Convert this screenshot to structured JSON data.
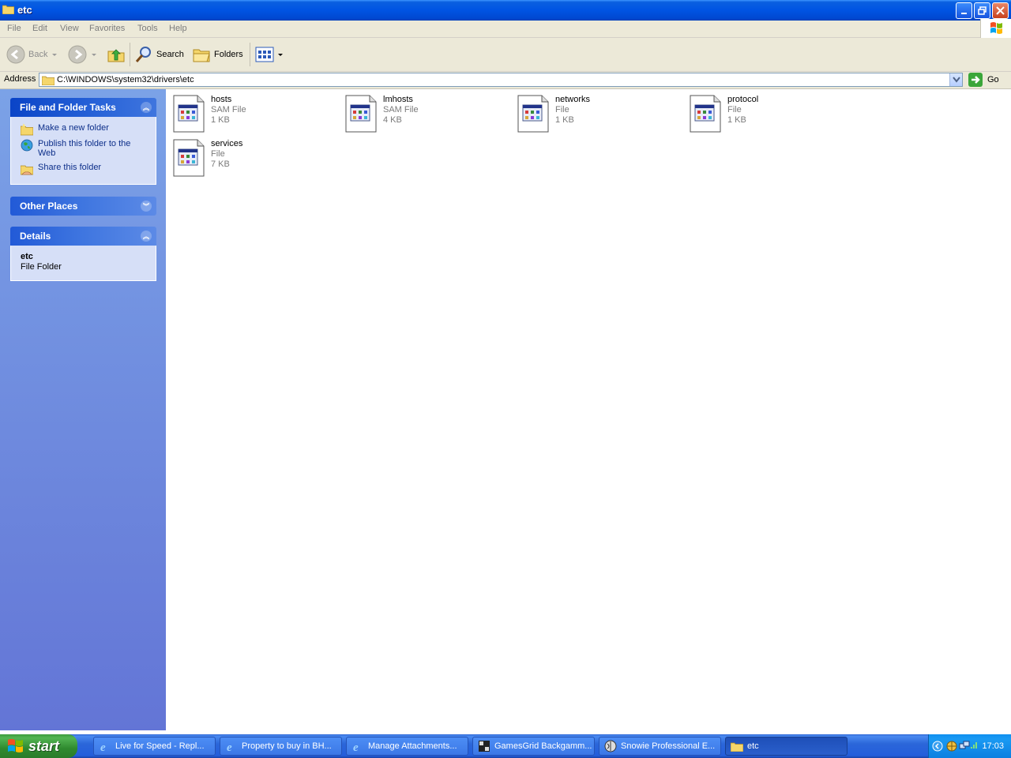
{
  "window": {
    "title": "etc"
  },
  "menu": {
    "items": [
      "File",
      "Edit",
      "View",
      "Favorites",
      "Tools",
      "Help"
    ]
  },
  "toolbar": {
    "back_label": "Back",
    "search_label": "Search",
    "folders_label": "Folders"
  },
  "address": {
    "label": "Address",
    "value": "C:\\WINDOWS\\system32\\drivers\\etc",
    "go_label": "Go"
  },
  "taskpane": {
    "file_tasks": {
      "title": "File and Folder Tasks",
      "items": [
        "Make a new folder",
        "Publish this folder to the Web",
        "Share this folder"
      ]
    },
    "other_places": {
      "title": "Other Places"
    },
    "details": {
      "title": "Details",
      "name": "etc",
      "type": "File Folder"
    }
  },
  "files": [
    {
      "name": "hosts",
      "type": "SAM File",
      "size": "1 KB"
    },
    {
      "name": "lmhosts",
      "type": "SAM File",
      "size": "4 KB"
    },
    {
      "name": "networks",
      "type": "File",
      "size": "1 KB"
    },
    {
      "name": "protocol",
      "type": "File",
      "size": "1 KB"
    },
    {
      "name": "services",
      "type": "File",
      "size": "7 KB"
    }
  ],
  "taskbar": {
    "start_label": "start",
    "buttons": [
      {
        "label": "Live for Speed - Repl...",
        "icon": "ie-icon"
      },
      {
        "label": "Property to buy in BH...",
        "icon": "ie-icon"
      },
      {
        "label": "Manage Attachments...",
        "icon": "ie-icon"
      },
      {
        "label": "GamesGrid Backgamm...",
        "icon": "backgammon-icon"
      },
      {
        "label": "Snowie Professional E...",
        "icon": "snowie-icon"
      },
      {
        "label": "etc",
        "icon": "folder-icon"
      }
    ],
    "clock": "17:03"
  },
  "colors": {
    "titlebar": "#0054e3",
    "taskpane": "#7ba2e7",
    "panel_body": "#d6dff7",
    "link": "#0c2e89"
  }
}
